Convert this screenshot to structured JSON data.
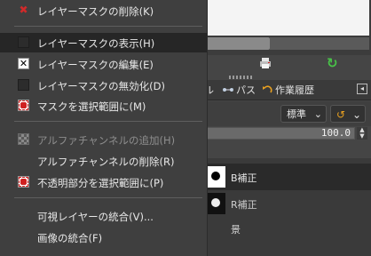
{
  "menu": {
    "items": [
      {
        "id": "delete-mask",
        "label": "レイヤーマスクの削除(K)",
        "icon": "red-x-icon",
        "enabled": true
      },
      {
        "id": "show-mask",
        "label": "レイヤーマスクの表示(H)",
        "icon": "checkbox-empty-icon",
        "enabled": true,
        "highlighted": true
      },
      {
        "id": "edit-mask",
        "label": "レイヤーマスクの編集(E)",
        "icon": "checkbox-checked-icon",
        "enabled": true
      },
      {
        "id": "disable-mask",
        "label": "レイヤーマスクの無効化(D)",
        "icon": "checkbox-empty-icon",
        "enabled": true
      },
      {
        "id": "mask-to-selection",
        "label": "マスクを選択範囲に(M)",
        "icon": "mask-to-selection-icon",
        "enabled": true
      },
      {
        "id": "add-alpha",
        "label": "アルファチャンネルの追加(H)",
        "icon": "alpha-channel-icon",
        "enabled": false
      },
      {
        "id": "remove-alpha",
        "label": "アルファチャンネルの削除(R)",
        "icon": "",
        "enabled": true
      },
      {
        "id": "alpha-to-selection",
        "label": "不透明部分を選択範囲に(P)",
        "icon": "alpha-to-selection-icon",
        "enabled": true
      },
      {
        "id": "merge-visible",
        "label": "可視レイヤーの統合(V)...",
        "icon": "",
        "enabled": true
      },
      {
        "id": "flatten-image",
        "label": "画像の統合(F)",
        "icon": "",
        "enabled": true
      }
    ]
  },
  "panel": {
    "tabs": [
      {
        "label": "ル"
      },
      {
        "label": "パス"
      },
      {
        "label": "作業履歴"
      }
    ],
    "mode_value": "標準",
    "opacity_value": "100.0",
    "layers": [
      {
        "name": "B補正",
        "selected": true
      },
      {
        "name": "R補正",
        "selected": false
      },
      {
        "name": "景",
        "selected": false
      }
    ]
  },
  "colors": {
    "menu_bg": "#3f3f3f",
    "highlight": "#262626",
    "red_icon": "#d02a2a",
    "refresh_icon": "#48c248"
  }
}
